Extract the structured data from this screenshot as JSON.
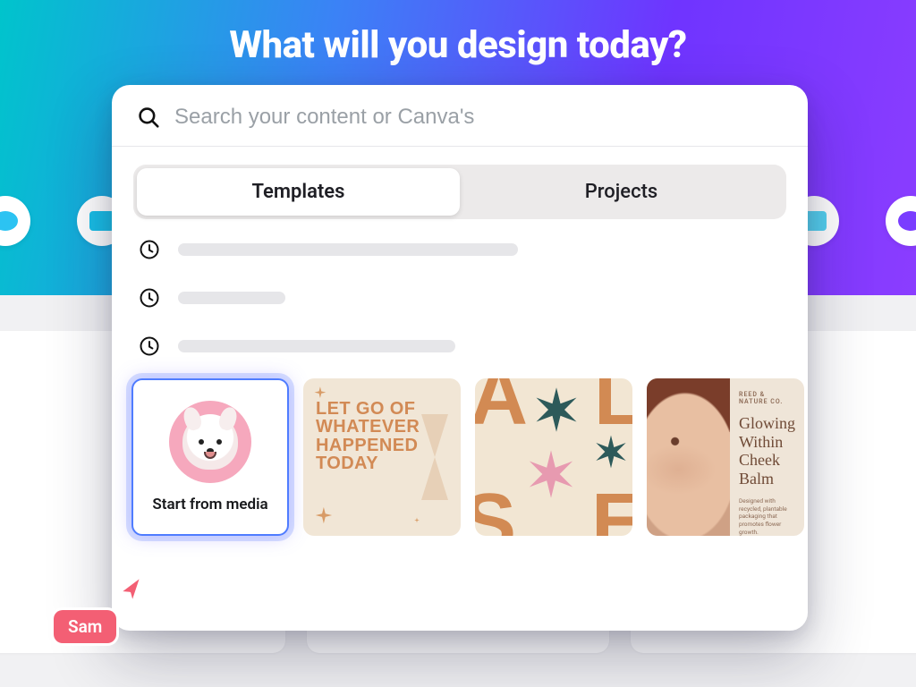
{
  "hero": {
    "title": "What will you design today?"
  },
  "search": {
    "placeholder": "Search your content or Canva's",
    "value": ""
  },
  "tabs": {
    "templates": "Templates",
    "projects": "Projects",
    "active": "templates"
  },
  "start_card": {
    "label": "Start from media"
  },
  "templates": {
    "quote": {
      "line1": "LET GO OF",
      "line2": "WHATEVER",
      "line3": "HAPPENED",
      "line4": "TODAY"
    },
    "letters": {
      "a": "A",
      "l": "L",
      "s": "S",
      "e": "E"
    },
    "product": {
      "brand": "REED & NATURE CO.",
      "headline": "Glowing Within Cheek Balm",
      "fineprint": "Designed with recycled, plantable packaging that promotes flower growth."
    }
  },
  "collaborator": {
    "name": "Sam"
  },
  "colors": {
    "accent_blue": "#4f7cff",
    "tag_pink": "#f35f74",
    "template_orange": "#d28a55",
    "template_cream": "#f1e6d6"
  }
}
